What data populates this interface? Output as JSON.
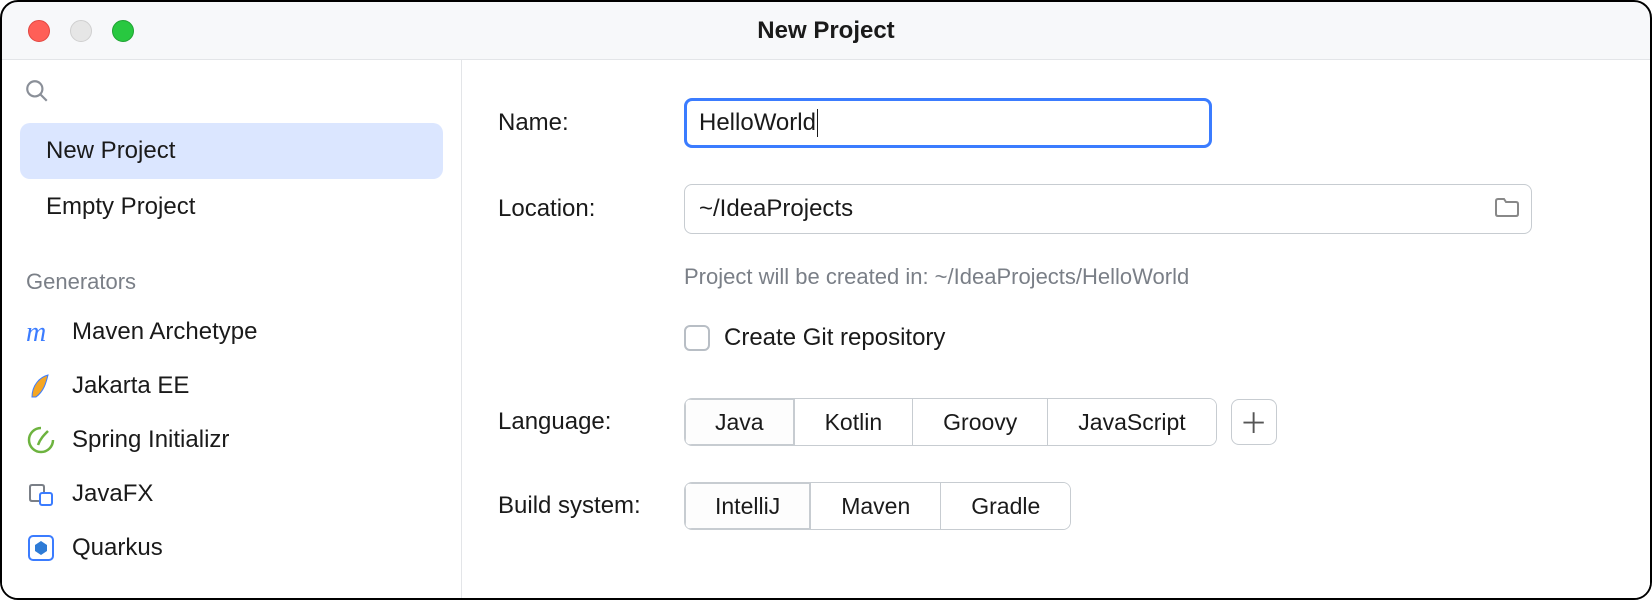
{
  "window": {
    "title": "New Project"
  },
  "sidebar": {
    "categories": [
      {
        "label": "New Project",
        "selected": true
      },
      {
        "label": "Empty Project",
        "selected": false
      }
    ],
    "section_label": "Generators",
    "generators": [
      {
        "icon": "maven-icon",
        "label": "Maven Archetype"
      },
      {
        "icon": "jakarta-icon",
        "label": "Jakarta EE"
      },
      {
        "icon": "spring-icon",
        "label": "Spring Initializr"
      },
      {
        "icon": "javafx-icon",
        "label": "JavaFX"
      },
      {
        "icon": "quarkus-icon",
        "label": "Quarkus"
      }
    ]
  },
  "form": {
    "name_label": "Name:",
    "name_value": "HelloWorld",
    "location_label": "Location:",
    "location_value": "~/IdeaProjects",
    "hint": "Project will be created in: ~/IdeaProjects/HelloWorld",
    "git_label": "Create Git repository",
    "git_checked": false,
    "language_label": "Language:",
    "languages": [
      {
        "label": "Java",
        "selected": true
      },
      {
        "label": "Kotlin",
        "selected": false
      },
      {
        "label": "Groovy",
        "selected": false
      },
      {
        "label": "JavaScript",
        "selected": false
      }
    ],
    "build_label": "Build system:",
    "builds": [
      {
        "label": "IntelliJ",
        "selected": true
      },
      {
        "label": "Maven",
        "selected": false
      },
      {
        "label": "Gradle",
        "selected": false
      }
    ]
  }
}
